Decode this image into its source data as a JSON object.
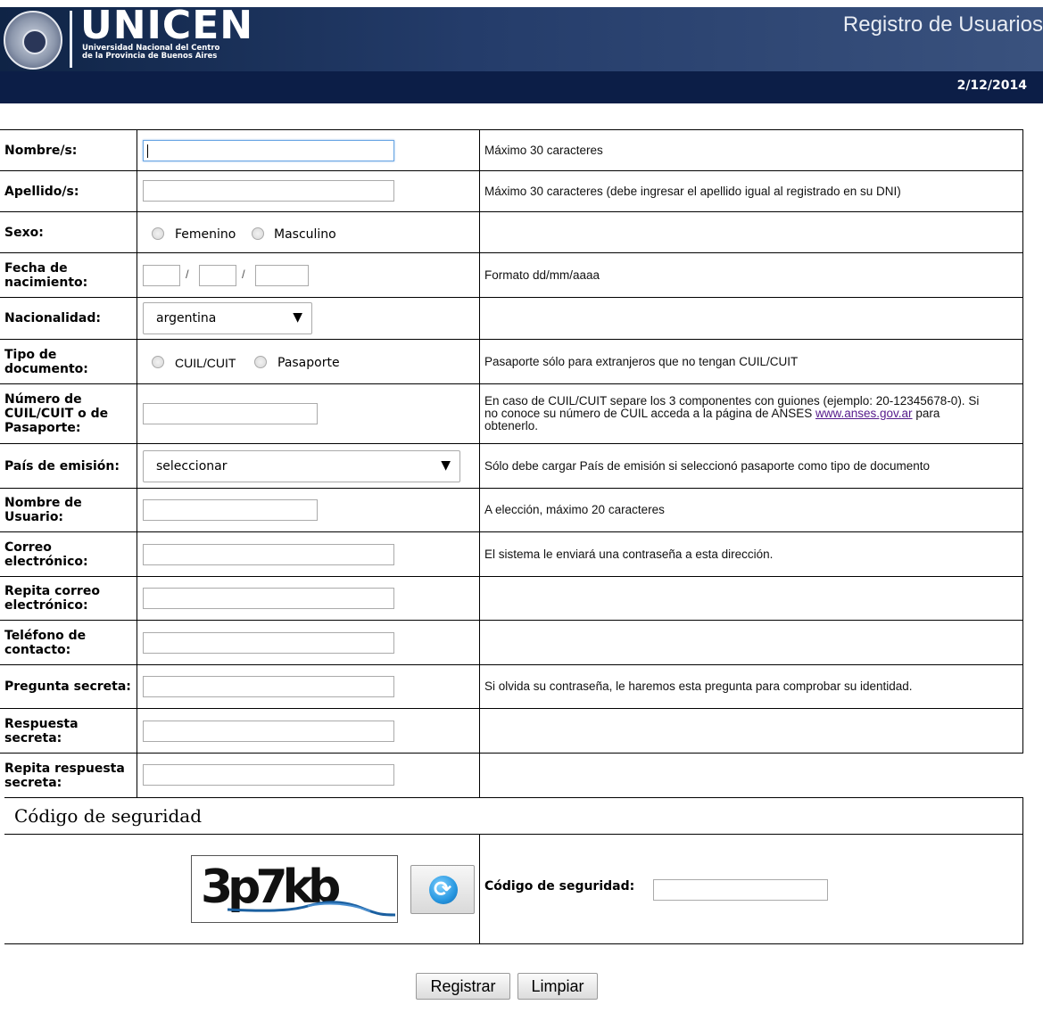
{
  "header": {
    "logo_name": "UNICEN",
    "logo_sub_1": "Universidad Nacional del Centro",
    "logo_sub_2": "de la Provincia de Buenos Aires",
    "title": "Registro de Usuarios",
    "date": "2/12/2014"
  },
  "form": {
    "nombre": {
      "label": "Nombre/s:",
      "help": "Máximo 30 caracteres",
      "value": ""
    },
    "apellido": {
      "label": "Apellido/s:",
      "help": "Máximo 30 caracteres (debe ingresar el apellido igual al registrado en su DNI)",
      "value": ""
    },
    "sexo": {
      "label": "Sexo:",
      "options": [
        "Femenino",
        "Masculino"
      ]
    },
    "fecha": {
      "label": "Fecha de nacimiento:",
      "help": "Formato dd/mm/aaaa",
      "separator": "/"
    },
    "nacionalidad": {
      "label": "Nacionalidad:",
      "selected": "argentina"
    },
    "tipo_doc": {
      "label": "Tipo de documento:",
      "options": [
        "CUIL/CUIT",
        "Pasaporte"
      ],
      "help": "Pasaporte sólo para extranjeros que no tengan CUIL/CUIT"
    },
    "numero_doc": {
      "label": "Número de CUIL/CUIT o de Pasaporte:",
      "help_before": "En caso de CUIL/CUIT separe los 3 componentes con guiones (ejemplo: 20-12345678-0). Si no conoce su número de CUIL acceda a la página de ANSES ",
      "help_link": "www.anses.gov.ar",
      "help_after": " para obtenerlo."
    },
    "pais_emision": {
      "label": "País de emisión:",
      "selected": "seleccionar",
      "help": "Sólo debe cargar País de emisión si seleccionó pasaporte como tipo de documento"
    },
    "usuario": {
      "label": "Nombre de Usuario:",
      "help": "A elección, máximo 20 caracteres"
    },
    "correo": {
      "label": "Correo electrónico:",
      "help": "El sistema le enviará una contraseña a esta dirección."
    },
    "correo2": {
      "label": "Repita correo electrónico:"
    },
    "telefono": {
      "label": "Teléfono de contacto:"
    },
    "pregunta": {
      "label": "Pregunta secreta:",
      "help": "Si olvida su contraseña, le haremos esta pregunta para comprobar su identidad."
    },
    "respuesta": {
      "label": "Respuesta secreta:"
    },
    "respuesta2": {
      "label": "Repita respuesta secreta:"
    }
  },
  "captcha": {
    "legend": "Código de seguridad",
    "image_text": "3p7kb",
    "label": "Código de seguridad:",
    "value": ""
  },
  "buttons": {
    "submit": "Registrar",
    "reset": "Limpiar"
  }
}
